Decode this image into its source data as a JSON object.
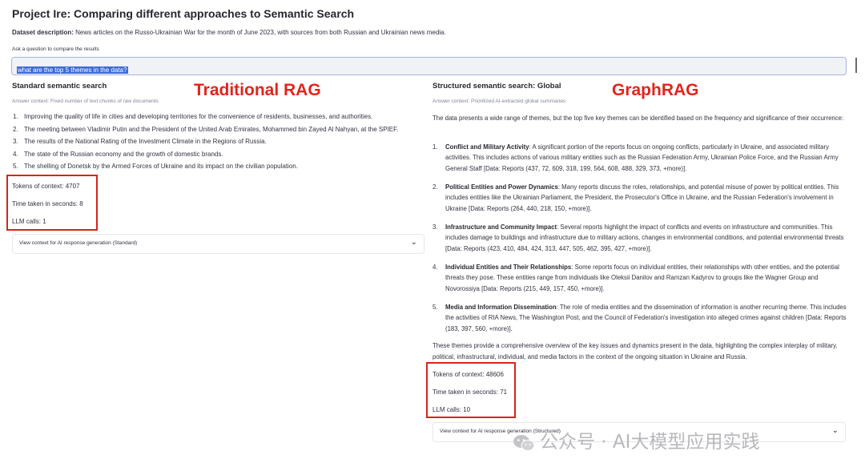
{
  "header": {
    "title": "Project Ire: Comparing different approaches to Semantic Search",
    "dataset_label": "Dataset description:",
    "dataset_text": " News articles on the Russo-Ukrainian War for the month of June 2023, with sources from both Russian and Ukrainian news media.",
    "ask_label": "Ask a question to compare the results"
  },
  "query": {
    "value": "what are the top 5 themes in the data?"
  },
  "left": {
    "title": "Standard semantic search",
    "caption": "Answer context: Fixed number of text chunks of raw documents",
    "annotation": "Traditional RAG",
    "items": [
      {
        "num": "1.",
        "text": "Improving the quality of life in cities and developing territories for the convenience of residents, businesses, and authorities."
      },
      {
        "num": "2.",
        "text": "The meeting between Vladimir Putin and the President of the United Arab Emirates, Mohammed bin Zayed Al Nahyan, at the SPIEF."
      },
      {
        "num": "3.",
        "text": "The results of the National Rating of the Investment Climate in the Regions of Russia."
      },
      {
        "num": "4.",
        "text": "The state of the Russian economy and the growth of domestic brands."
      },
      {
        "num": "5.",
        "text": "The shelling of Donetsk by the Armed Forces of Ukraine and its impact on the civilian population."
      }
    ],
    "tokens": "Tokens of context: 4707",
    "time": "Time taken in seconds: 8",
    "llm_calls": "LLM calls: 1",
    "expander_label": "View context for AI response generation (Standard)"
  },
  "right": {
    "title": "Structured semantic search: Global",
    "caption": "Answer context: Prioritized AI-extracted global summaries",
    "annotation": "GraphRAG",
    "intro": "The data presents a wide range of themes, but the top five key themes can be identified based on the frequency and significance of their occurrence:",
    "items": [
      {
        "num": "1.",
        "head": "Conflict and Military Activity",
        "text": ": A significant portion of the reports focus on ongoing conflicts, particularly in Ukraine, and associated military activities. This includes actions of various military entities such as the Russian Federation Army, Ukrainian Police Force, and the Russian Army General Staff [Data: Reports (437, 72, 609, 318, 199, 564, 608, 488, 329, 373, +more)]."
      },
      {
        "num": "2.",
        "head": "Political Entities and Power Dynamics",
        "text": ": Many reports discuss the roles, relationships, and potential misuse of power by political entities. This includes entities like the Ukrainian Parliament, the President, the Prosecutor's Office in Ukraine, and the Russian Federation's involvement in Ukraine [Data: Reports (264, 440, 218, 150, +more)]."
      },
      {
        "num": "3.",
        "head": "Infrastructure and Community Impact",
        "text": ": Several reports highlight the impact of conflicts and events on infrastructure and communities. This includes damage to buildings and infrastructure due to military actions, changes in environmental conditions, and potential environmental threats [Data: Reports (423, 410, 484, 424, 313, 447, 505, 462, 395, 427, +more)]."
      },
      {
        "num": "4.",
        "head": "Individual Entities and Their Relationships",
        "text": ": Some reports focus on individual entities, their relationships with other entities, and the potential threats they pose. These entities range from individuals like Oleksii Danilov and Ramzan Kadyrov to groups like the Wagner Group and Novorossiya [Data: Reports (215, 449, 157, 450, +more)]."
      },
      {
        "num": "5.",
        "head": "Media and Information Dissemination",
        "text": ": The role of media entities and the dissemination of information is another recurring theme. This includes the activities of RIA News, The Washington Post, and the Council of Federation's investigation into alleged crimes against children [Data: Reports (183, 397, 560, +more)]."
      }
    ],
    "outro": "These themes provide a comprehensive overview of the key issues and dynamics present in the data, highlighting the complex interplay of military, political, infrastructural, individual, and media factors in the context of the ongoing situation in Ukraine and Russia.",
    "tokens": "Tokens of context: 48606",
    "time": "Time taken in seconds: 71",
    "llm_calls": "LLM calls: 10",
    "expander_label": "View context for AI response generation (Structured)"
  },
  "watermark": {
    "text": "公众号 · AI大模型应用实践"
  },
  "icons": {
    "chevron": "chevron-down-icon",
    "wechat": "wechat-icon"
  },
  "colors": {
    "annotation_red": "#e2241d",
    "query_highlight": "#3d6bd8",
    "box_red": "#d9231d"
  }
}
